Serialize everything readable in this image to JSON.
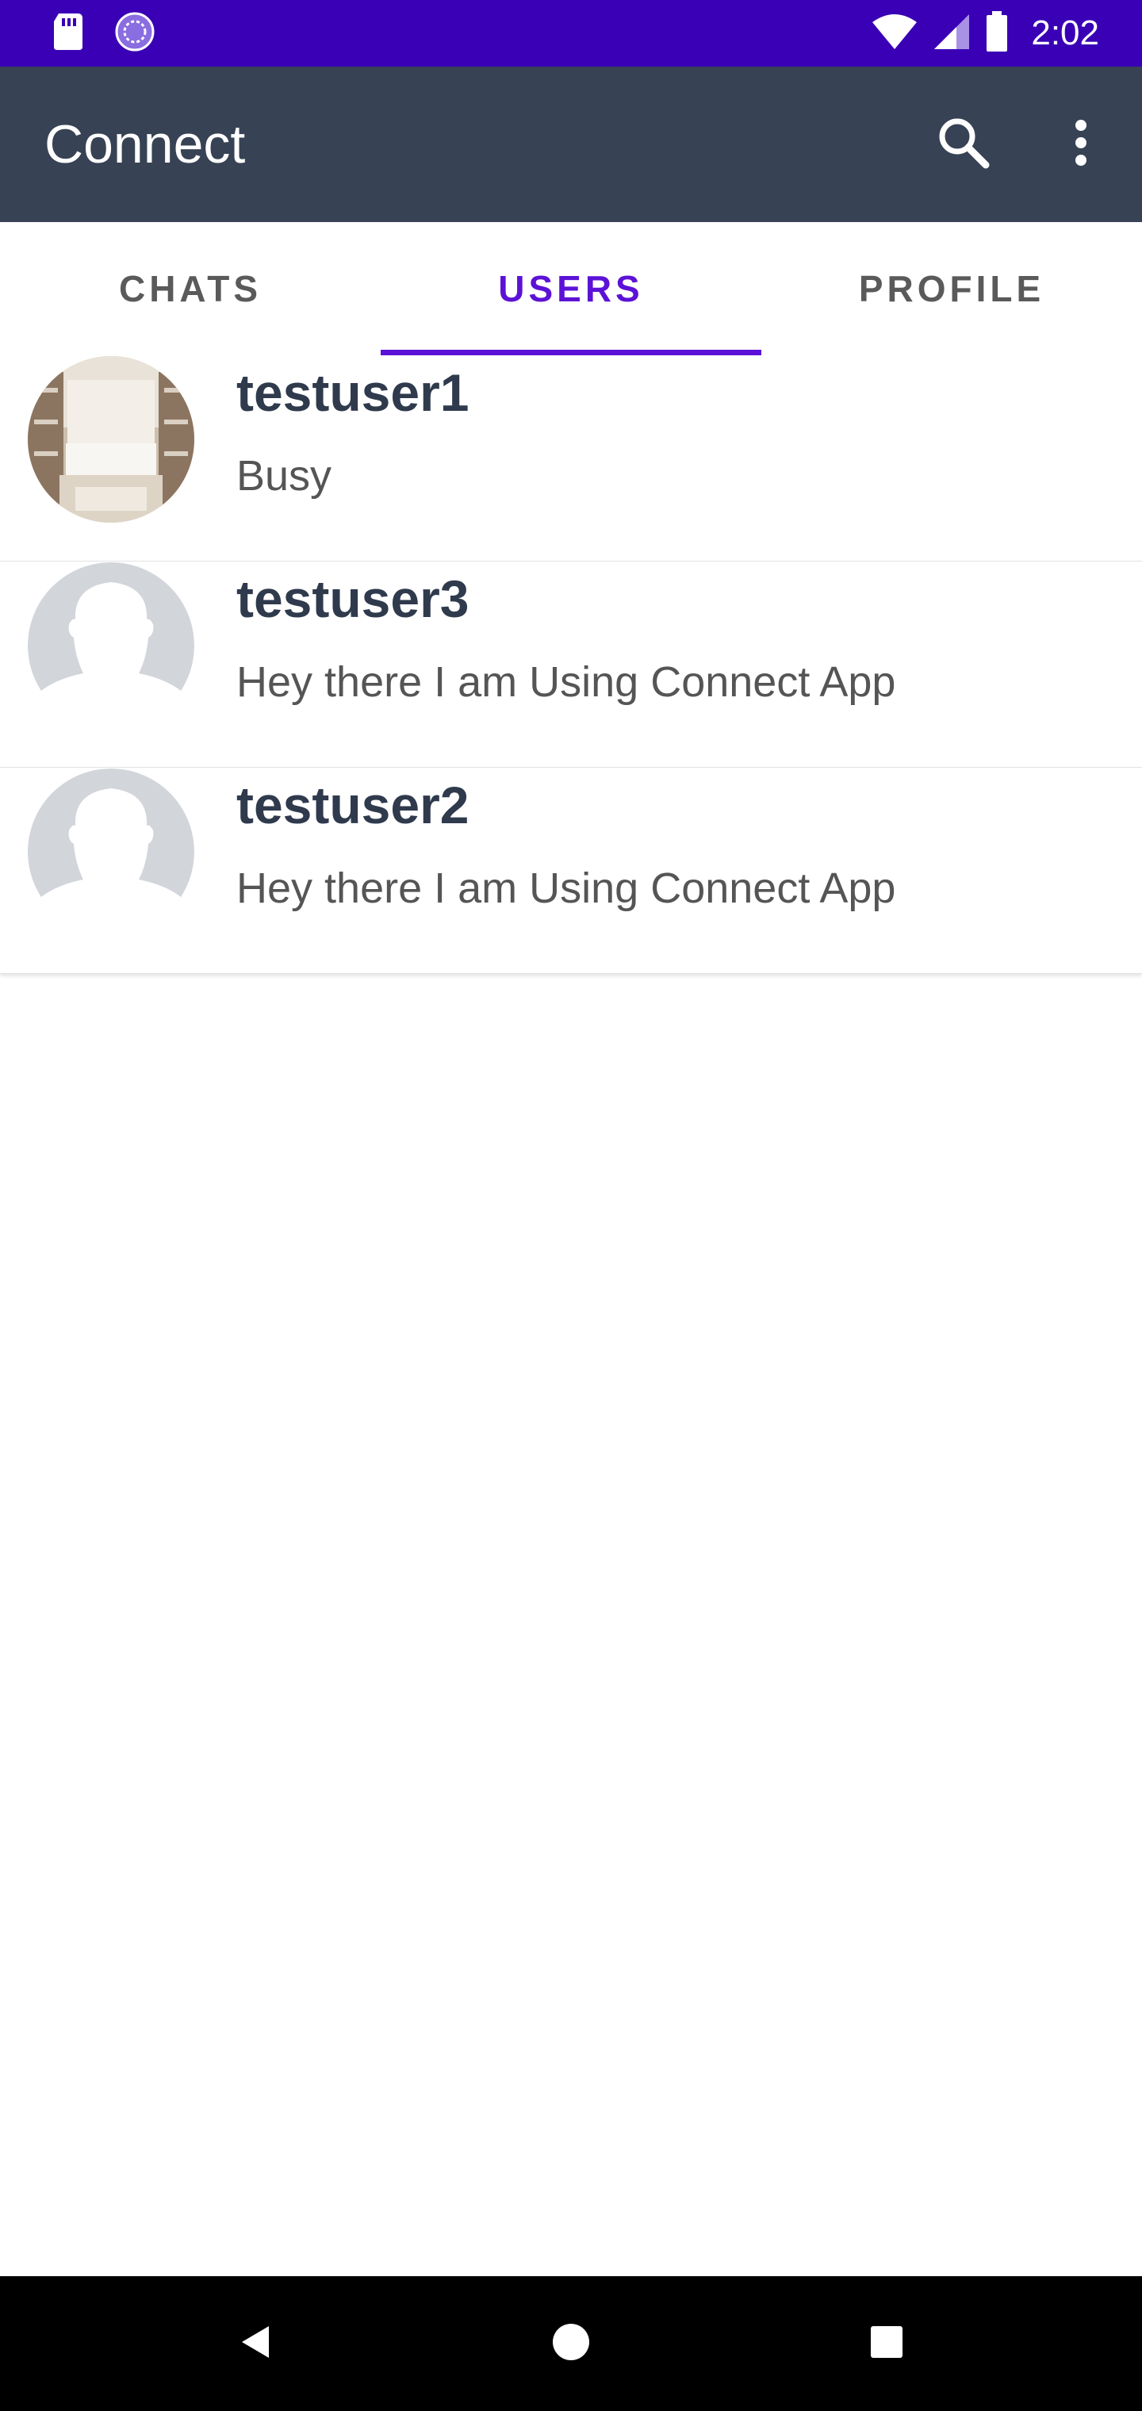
{
  "status_bar": {
    "time": "2:02",
    "icons": [
      "sd-card-icon",
      "sync-icon",
      "wifi-icon",
      "signal-icon",
      "battery-icon"
    ]
  },
  "app_bar": {
    "title": "Connect",
    "actions": [
      "search-icon",
      "more-vert-icon"
    ]
  },
  "tabs": [
    {
      "label": "CHATS",
      "active": false
    },
    {
      "label": "USERS",
      "active": true
    },
    {
      "label": "PROFILE",
      "active": false
    }
  ],
  "users": [
    {
      "name": "testuser1",
      "status": "Busy",
      "avatar": "room-photo"
    },
    {
      "name": "testuser3",
      "status": "Hey there I am Using Connect App",
      "avatar": "default-person"
    },
    {
      "name": "testuser2",
      "status": "Hey there I am Using Connect App",
      "avatar": "default-person"
    }
  ],
  "nav_bar": {
    "buttons": [
      "back-icon",
      "home-icon",
      "recents-icon"
    ]
  },
  "colors": {
    "status_bar": "#3a00b6",
    "app_bar": "#374254",
    "accent": "#5c12d6",
    "user_name": "#2f3a4d"
  }
}
